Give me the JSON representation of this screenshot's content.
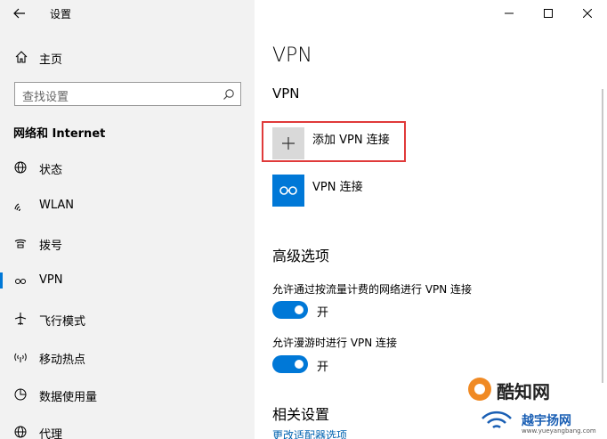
{
  "window": {
    "title": "设置",
    "controls": [
      "minimize",
      "maximize",
      "close"
    ]
  },
  "sidebar": {
    "home_label": "主页",
    "search_placeholder": "查找设置",
    "section_heading": "网络和 Internet",
    "items": [
      {
        "label": "状态",
        "icon": "globe-icon"
      },
      {
        "label": "WLAN",
        "icon": "wifi-icon"
      },
      {
        "label": "拨号",
        "icon": "dialup-icon"
      },
      {
        "label": "VPN",
        "icon": "vpn-icon",
        "active": true
      },
      {
        "label": "飞行模式",
        "icon": "airplane-icon"
      },
      {
        "label": "移动热点",
        "icon": "hotspot-icon"
      },
      {
        "label": "数据使用量",
        "icon": "data-usage-icon"
      },
      {
        "label": "代理",
        "icon": "proxy-icon"
      }
    ]
  },
  "main": {
    "page_title": "VPN",
    "section_title": "VPN",
    "add_vpn_label": "添加 VPN 连接",
    "vpn_connection_label": "VPN 连接",
    "advanced_title": "高级选项",
    "option_metered": "允许通过按流量计费的网络进行 VPN 连接",
    "option_metered_state": "开",
    "option_roaming": "允许漫游时进行 VPN 连接",
    "option_roaming_state": "开",
    "related_title": "相关设置",
    "related_link": "更改适配器选项"
  },
  "watermark": {
    "line1": "酷知网",
    "line2": "越宇扬网",
    "line3": "www.yueyangbang.com"
  },
  "colors": {
    "accent": "#0078d7",
    "highlight": "#e03a3a",
    "sidebar_bg": "#f2f2f2"
  }
}
